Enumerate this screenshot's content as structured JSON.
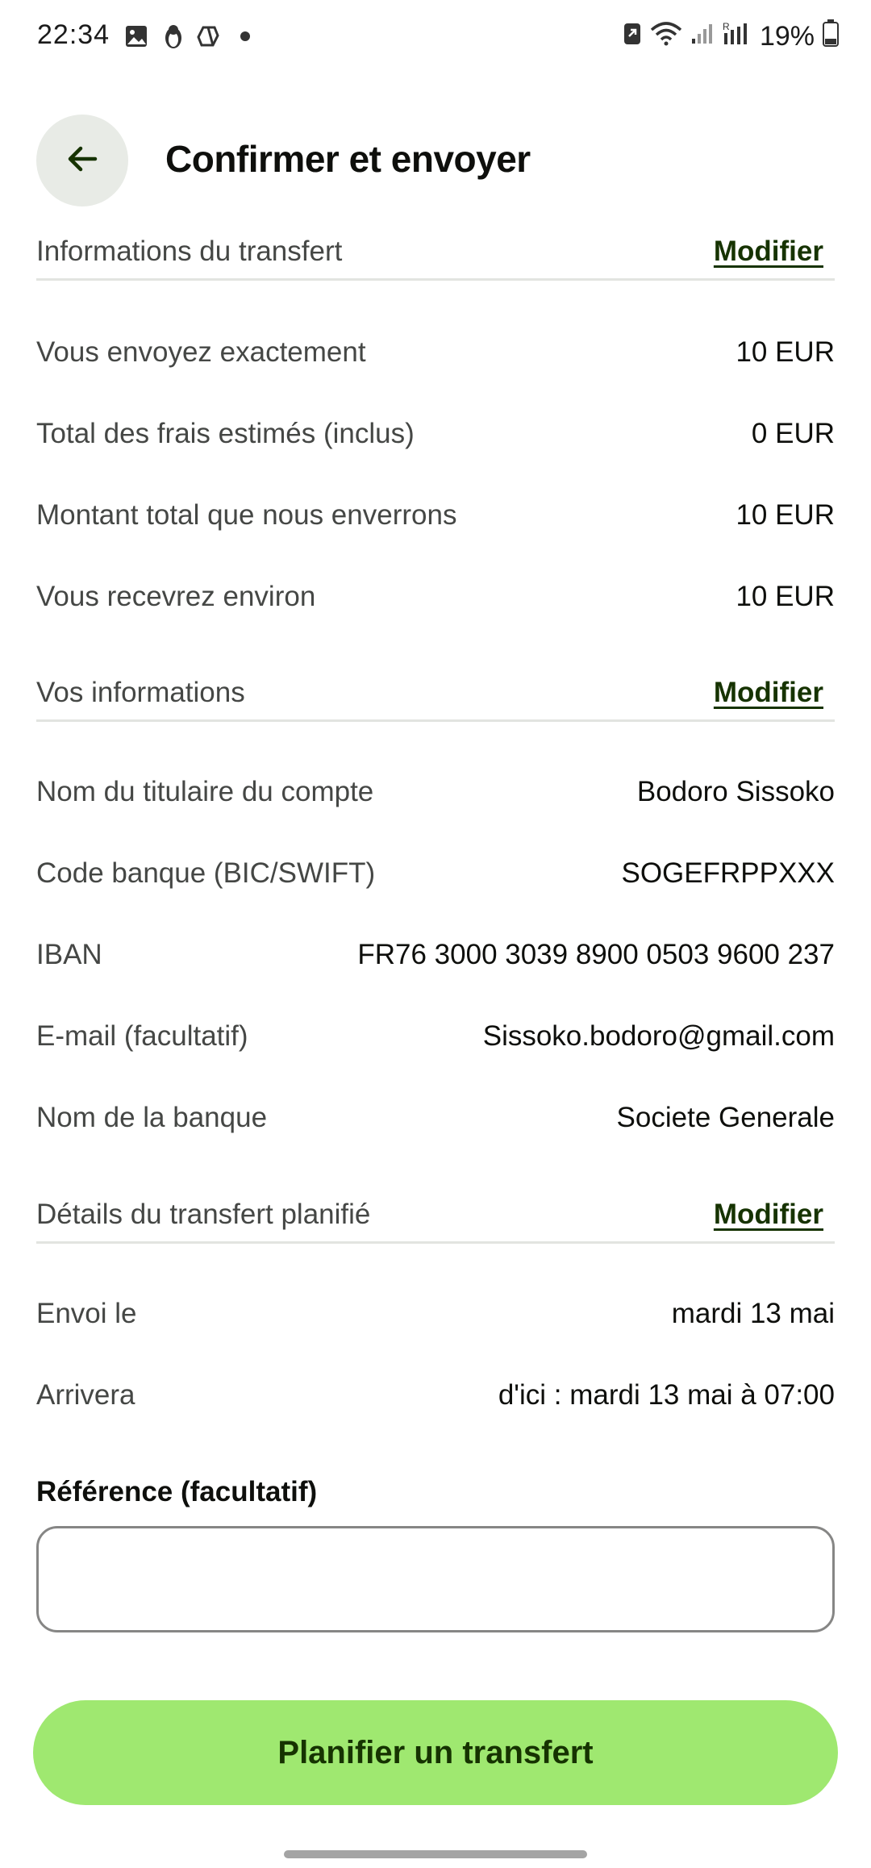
{
  "status_bar": {
    "time": "22:34",
    "battery": "19%"
  },
  "header": {
    "title": "Confirmer et envoyer"
  },
  "sections": {
    "transfer_info": {
      "title": "Informations du transfert",
      "action": "Modifier",
      "rows": [
        {
          "label": "Vous envoyez exactement",
          "value": "10 EUR"
        },
        {
          "label": "Total des frais estimés (inclus)",
          "value": "0 EUR"
        },
        {
          "label": "Montant total que nous enverrons",
          "value": "10 EUR"
        },
        {
          "label": "Vous recevrez environ",
          "value": "10 EUR"
        }
      ]
    },
    "your_info": {
      "title": "Vos informations",
      "action": "Modifier",
      "rows": [
        {
          "label": "Nom du titulaire du compte",
          "value": "Bodoro Sissoko"
        },
        {
          "label": "Code banque (BIC/SWIFT)",
          "value": "SOGEFRPPXXX"
        },
        {
          "label": "IBAN",
          "value": "FR76 3000 3039 8900 0503 9600 237"
        },
        {
          "label": "E-mail (facultatif)",
          "value": "Sissoko.bodoro@gmail.com"
        },
        {
          "label": "Nom de la banque",
          "value": "Societe Generale"
        }
      ]
    },
    "scheduled": {
      "title": "Détails du transfert planifié",
      "action": "Modifier",
      "rows": [
        {
          "label": "Envoi le",
          "value": "mardi 13 mai"
        },
        {
          "label": "Arrivera",
          "value": "d'ici : mardi 13 mai à 07:00"
        }
      ]
    }
  },
  "reference": {
    "label": "Référence (facultatif)",
    "value": ""
  },
  "cta": {
    "label": "Planifier un transfert"
  },
  "icons": {
    "back": "arrow-left-icon"
  },
  "colors": {
    "accent_green": "#9fe870",
    "dark_green": "#163300",
    "back_button_bg": "#e8ebe6",
    "divider": "#e2e4e0"
  }
}
